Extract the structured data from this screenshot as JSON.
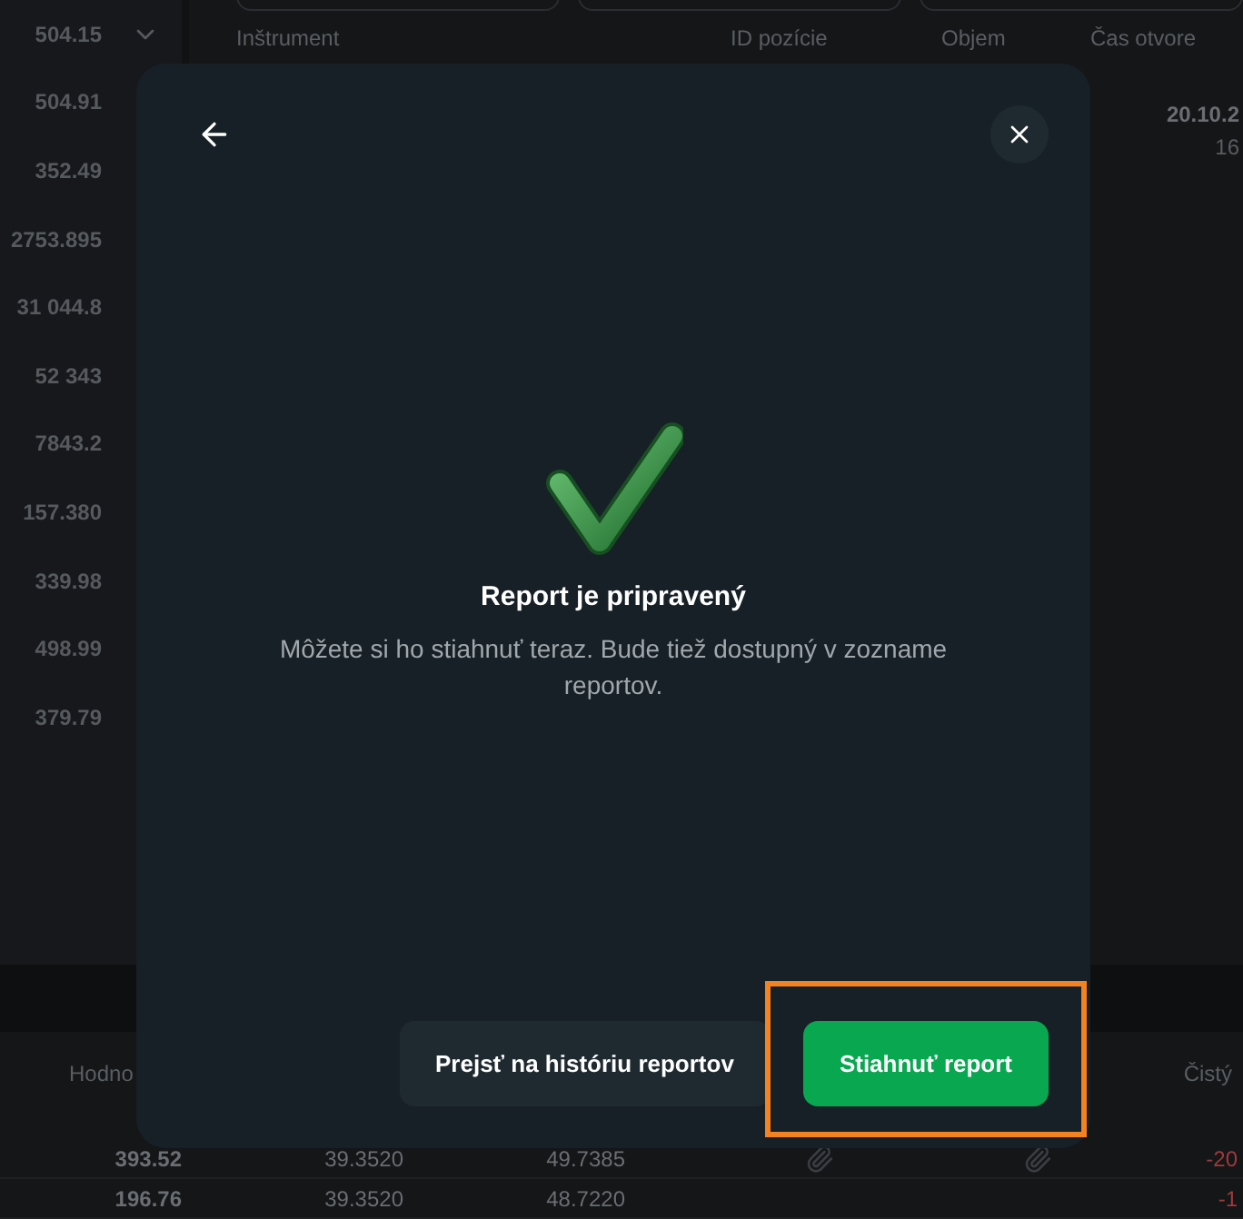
{
  "background": {
    "price_column": [
      "504.15",
      "504.91",
      "352.49",
      "2753.895",
      "31 044.8",
      "52 343",
      "7843.2",
      "157.380",
      "339.98",
      "498.99",
      "379.79"
    ],
    "table_header": [
      "Inštrument",
      "ID pozície",
      "Objem",
      "Čas otvore"
    ],
    "first_row": {
      "date": "20.10.2",
      "time": "16"
    },
    "bottom_headers": [
      "Hodno",
      "Čistý"
    ],
    "bottom_rows": [
      {
        "cells": [
          "393.52",
          "39.3520",
          "49.7385"
        ],
        "pnl": "-20",
        "attachments": true
      },
      {
        "cells": [
          "196.76",
          "39.3520",
          "48.7220"
        ],
        "pnl": "-1",
        "attachments": false
      }
    ]
  },
  "dialog": {
    "title": "Report je pripravený",
    "message": "Môžete si ho stiahnuť teraz. Bude tiež dostupný v zozname reportov.",
    "buttons": [
      {
        "label": "Prejsť na históriu reportov",
        "kind": "secondary"
      },
      {
        "label": "Stiahnuť report",
        "kind": "primary",
        "highlighted": true
      }
    ]
  }
}
